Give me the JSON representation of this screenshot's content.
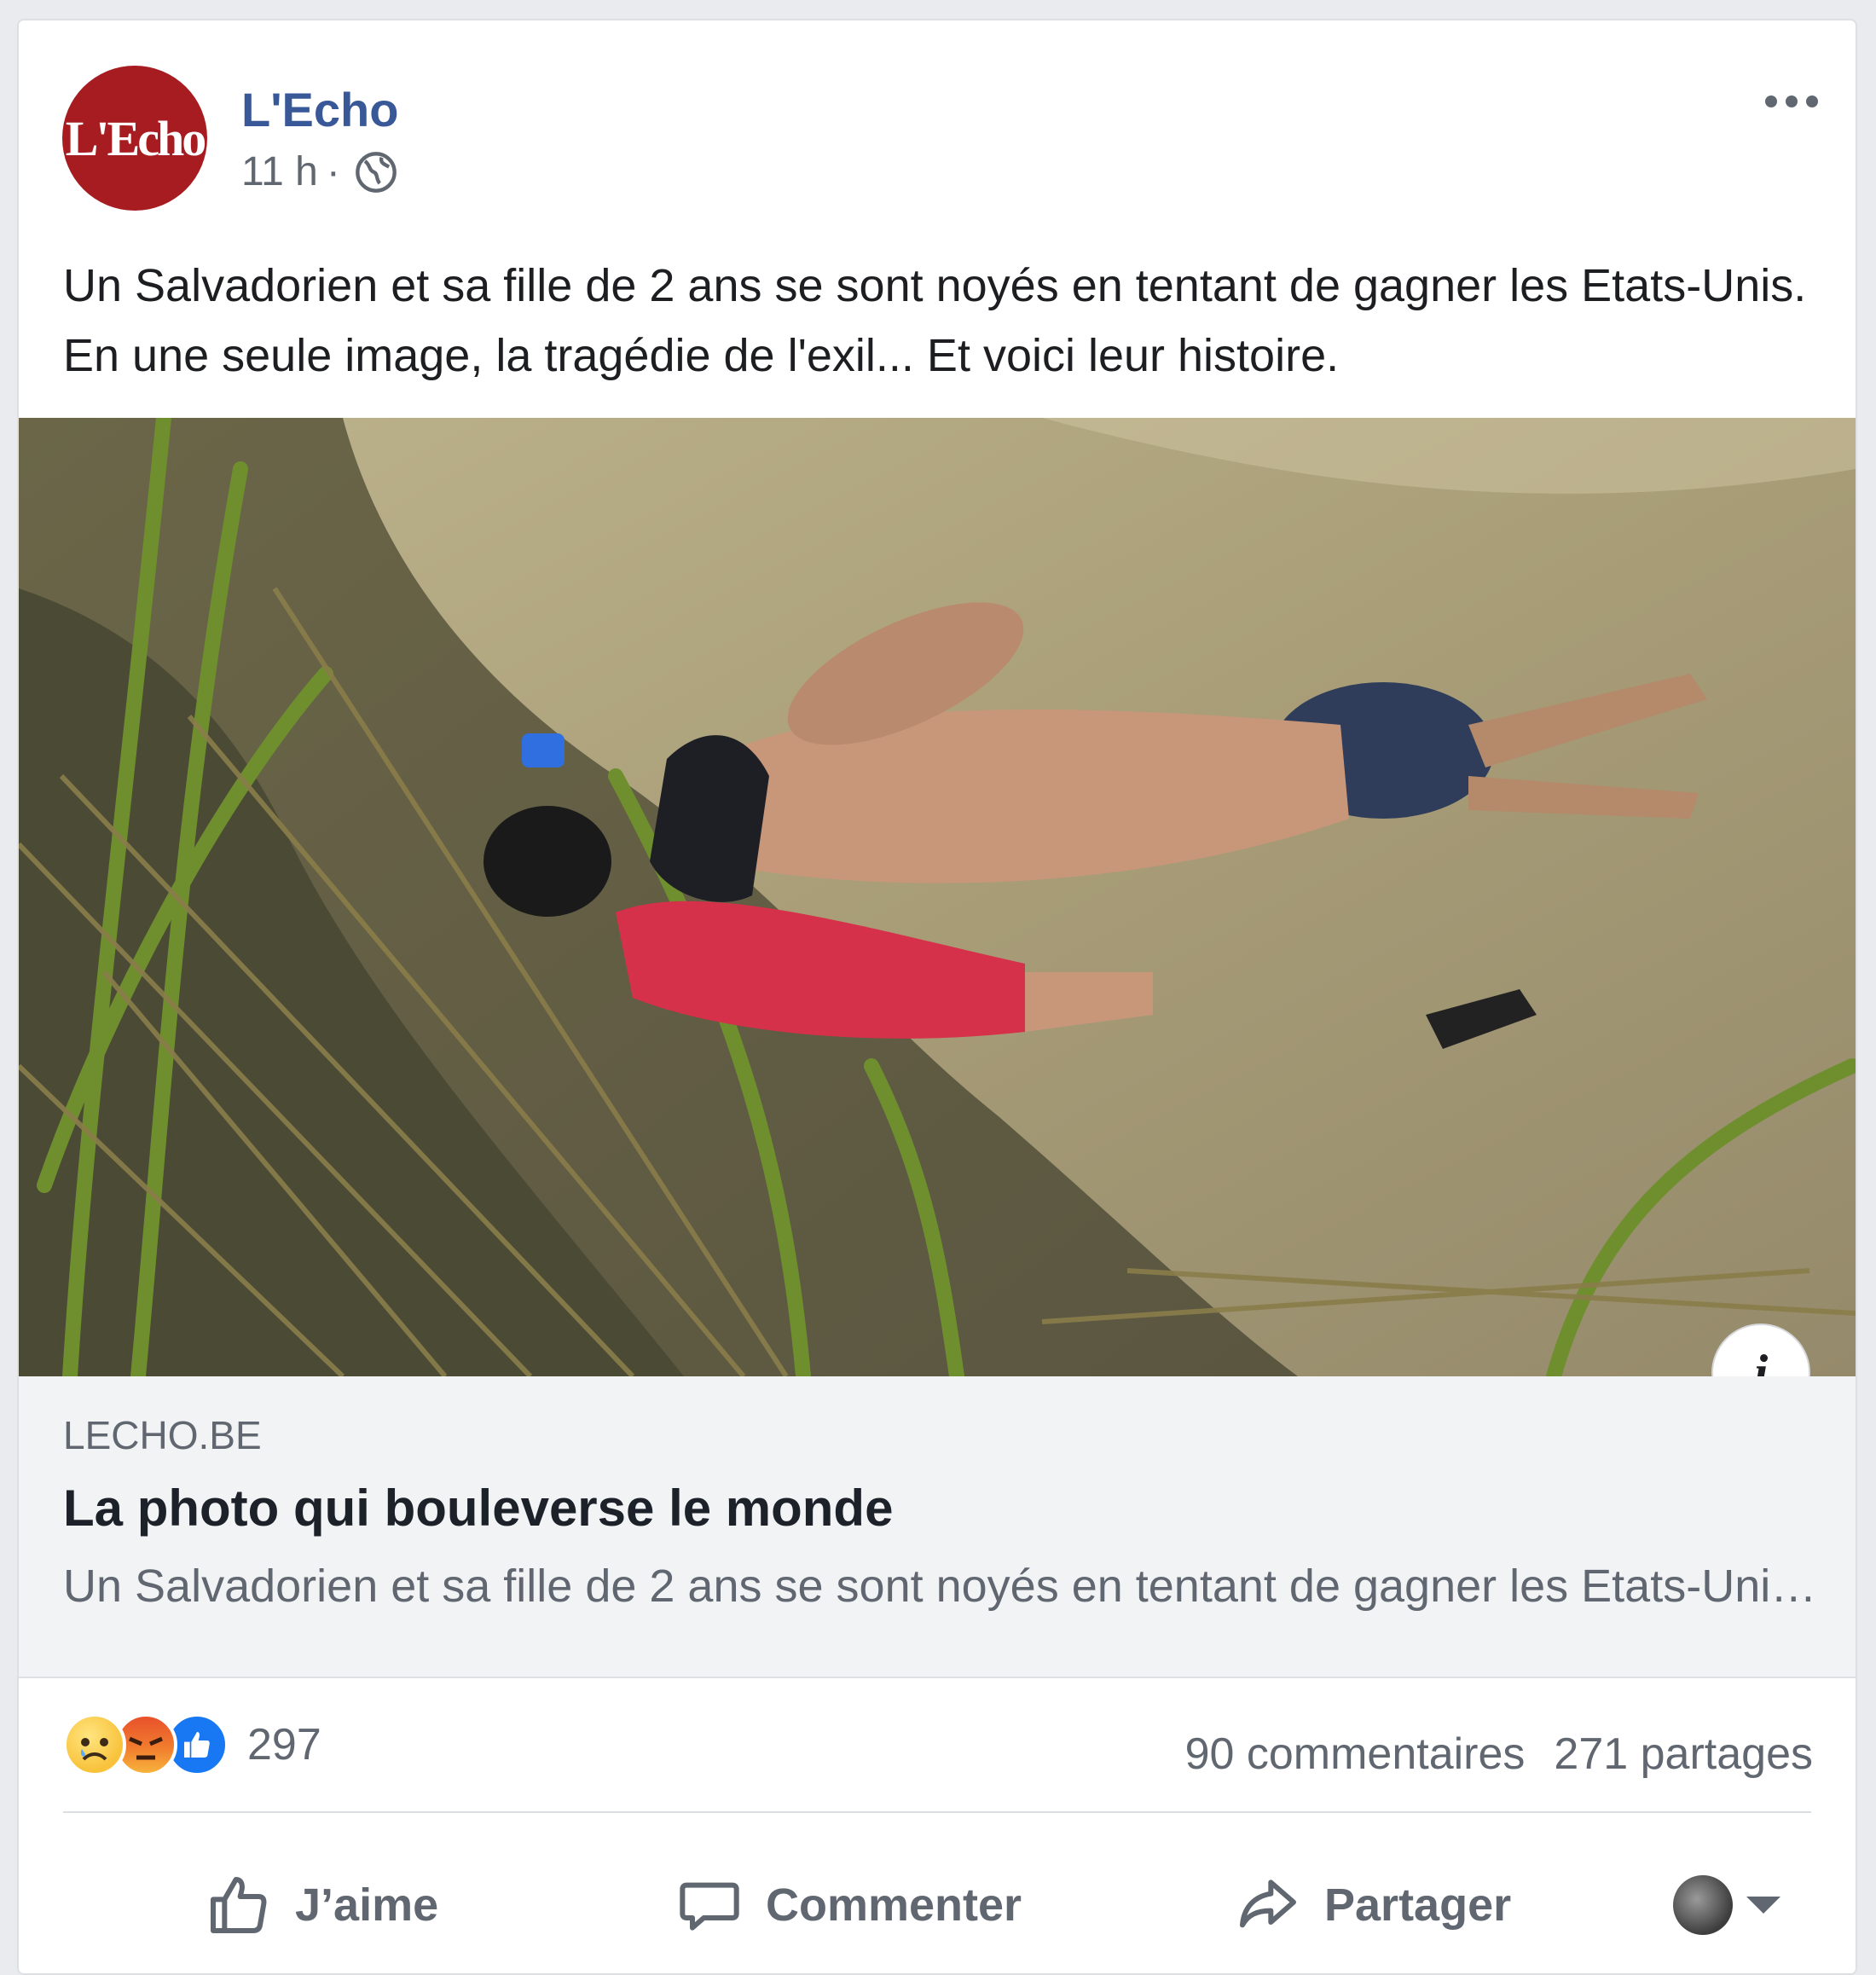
{
  "post": {
    "avatar_text": "L'Echo",
    "page_name": "L'Echo",
    "time": "11 h",
    "separator": "·",
    "privacy_icon": "globe-icon",
    "text": "Un Salvadorien et sa fille de 2 ans se sont noyés en tentant de gagner les Etats-Unis. En une seule image, la tragédie de l'exil... Et voici leur histoire."
  },
  "link_preview": {
    "info_label": "i",
    "domain": "LECHO.BE",
    "title": "La photo qui bouleverse le monde",
    "description": "Un Salvadorien et sa fille de 2 ans se sont noyés en tentant de gagner les Etats-Unis. En une seule image, la tragédie de l'exil..."
  },
  "engagement": {
    "reaction_icons": [
      "sad-reaction-icon",
      "angry-reaction-icon",
      "like-reaction-icon"
    ],
    "reaction_count": "297",
    "comments": "90 commentaires",
    "shares": "271 partages"
  },
  "actions": {
    "like": "J’aime",
    "comment": "Commenter",
    "share": "Partager"
  },
  "colors": {
    "page_name": "#385898",
    "brand_avatar": "#a71c20",
    "like_blue": "#1877f2",
    "secondary_text": "#606770"
  }
}
